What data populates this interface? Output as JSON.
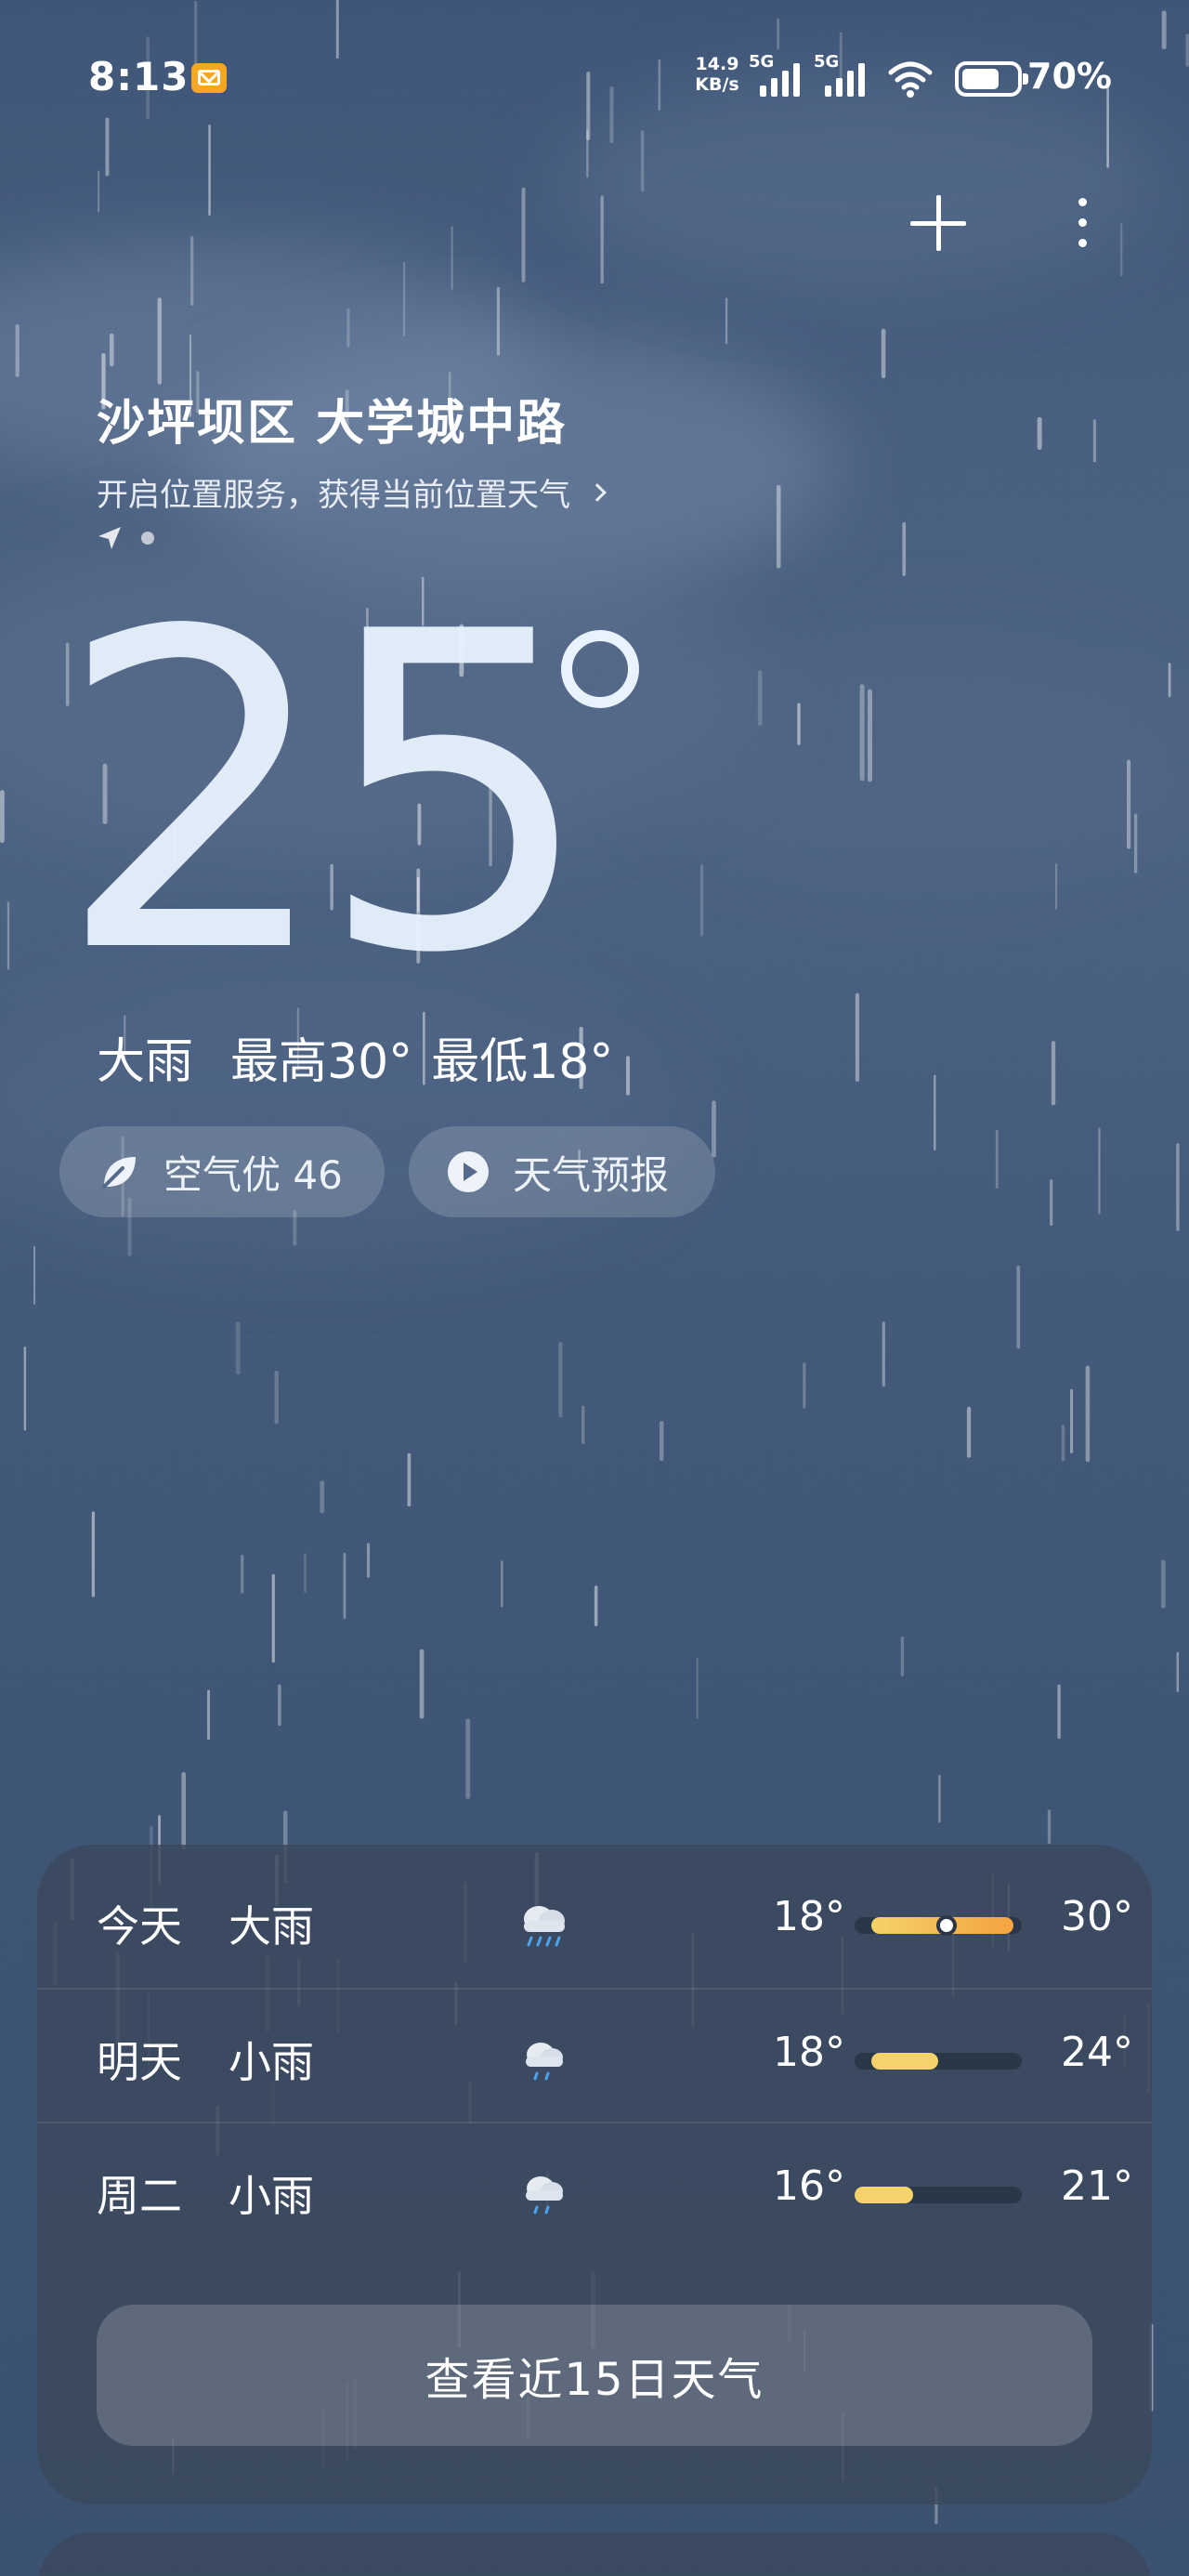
{
  "status_bar": {
    "time": "8:13",
    "net_speed_value": "14.9",
    "net_speed_unit": "KB/s",
    "sim1_label": "5G",
    "sim2_label": "5G",
    "battery_percent": "70%",
    "battery_level": 0.7
  },
  "location": {
    "name": "沙坪坝区 大学城中路",
    "service_prompt": "开启位置服务，获得当前位置天气"
  },
  "current": {
    "temperature": "25",
    "condition": "大雨",
    "high": "最高30°",
    "low": "最低18°"
  },
  "pills": {
    "air_quality": "空气优 46",
    "forecast_video": "天气预报"
  },
  "forecast": [
    {
      "day": "今天",
      "condition": "大雨",
      "icon": "heavy-rain-icon",
      "low": "18°",
      "high": "30°",
      "range": [
        0.1,
        0.95
      ],
      "now": 0.55
    },
    {
      "day": "明天",
      "condition": "小雨",
      "icon": "light-rain-icon",
      "low": "18°",
      "high": "24°",
      "range": [
        0.1,
        0.5
      ]
    },
    {
      "day": "周二",
      "condition": "小雨",
      "icon": "light-rain-icon",
      "low": "16°",
      "high": "21°",
      "range": [
        0.0,
        0.35
      ]
    }
  ],
  "forecast_more_label": "查看近15日天气",
  "colors": {
    "bar_cool": "#f5d36a",
    "bar_warm": "#f4a340",
    "card_bg": "#3a485c"
  }
}
